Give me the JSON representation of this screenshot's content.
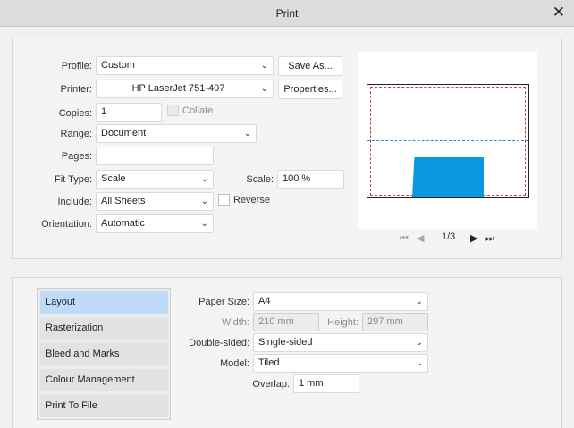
{
  "window": {
    "title": "Print",
    "close_label": "✕"
  },
  "form": {
    "profile": {
      "label": "Profile:",
      "value": "Custom",
      "button": "Save As..."
    },
    "printer": {
      "label": "Printer:",
      "value": "HP LaserJet 751-407",
      "button": "Properties..."
    },
    "copies": {
      "label": "Copies:",
      "value": "1",
      "collate_label": "Collate"
    },
    "range": {
      "label": "Range:",
      "value": "Document"
    },
    "pages": {
      "label": "Pages:",
      "value": ""
    },
    "fit_type": {
      "label": "Fit Type:",
      "value": "Scale"
    },
    "scale": {
      "label": "Scale:",
      "value": "100 %"
    },
    "include": {
      "label": "Include:",
      "value": "All Sheets",
      "reverse_label": "Reverse"
    },
    "orientation": {
      "label": "Orientation:",
      "value": "Automatic"
    }
  },
  "preview": {
    "page_indicator": "1/3",
    "shape_color": "#0a99e0"
  },
  "categories": [
    {
      "label": "Layout",
      "active": true
    },
    {
      "label": "Rasterization",
      "active": false
    },
    {
      "label": "Bleed and Marks",
      "active": false
    },
    {
      "label": "Colour Management",
      "active": false
    },
    {
      "label": "Print To File",
      "active": false
    }
  ],
  "layout": {
    "paper_size": {
      "label": "Paper Size:",
      "value": "A4"
    },
    "width": {
      "label": "Width:",
      "value": "210 mm"
    },
    "height": {
      "label": "Height:",
      "value": "297 mm"
    },
    "double_sided": {
      "label": "Double-sided:",
      "value": "Single-sided"
    },
    "model": {
      "label": "Model:",
      "value": "Tiled"
    },
    "overlap": {
      "label": "Overlap:",
      "value": "1 mm"
    }
  },
  "colors": {
    "accent": "#bedcf9",
    "red_margin": "#d23b3b",
    "blue_guide": "#3b7fd2"
  }
}
